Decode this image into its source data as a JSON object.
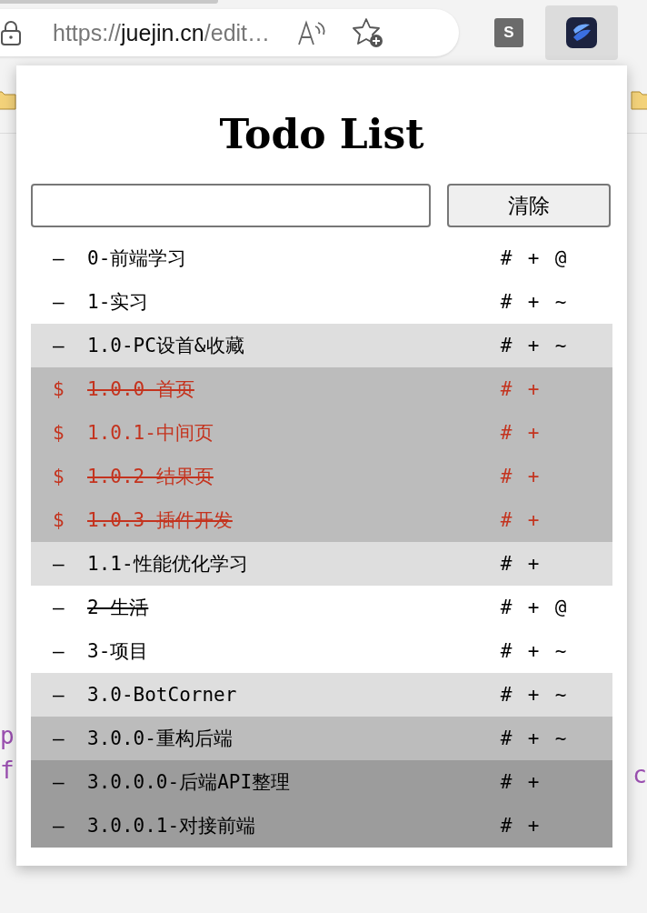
{
  "browser": {
    "url": {
      "scheme": "https://",
      "host": "juejin.cn",
      "path": "/edit…"
    },
    "extensions": [
      {
        "label": "S",
        "selected": false
      },
      {
        "kind": "app",
        "selected": true
      }
    ]
  },
  "page": {
    "left_fragments": [
      "p",
      "f"
    ],
    "right_fragments": [
      "c"
    ]
  },
  "popup": {
    "title": "Todo List",
    "clear_button": "清除",
    "items": [
      {
        "marker": "–",
        "text": "0-前端学习",
        "done": false,
        "highlighted": false,
        "actions": [
          "#",
          "+",
          "@"
        ]
      },
      {
        "marker": "–",
        "text": "1-实习",
        "done": false,
        "highlighted": false,
        "actions": [
          "#",
          "+",
          "~"
        ],
        "children": [
          {
            "marker": "–",
            "text": "1.0-PC设首&收藏",
            "done": false,
            "highlighted": false,
            "actions": [
              "#",
              "+",
              "~"
            ],
            "children": [
              {
                "marker": "$",
                "text": "1.0.0-首页",
                "done": true,
                "highlighted": true,
                "actions": [
                  "#",
                  "+"
                ]
              },
              {
                "marker": "$",
                "text": "1.0.1-中间页",
                "done": false,
                "highlighted": true,
                "actions": [
                  "#",
                  "+"
                ]
              },
              {
                "marker": "$",
                "text": "1.0.2-结果页",
                "done": true,
                "highlighted": true,
                "actions": [
                  "#",
                  "+"
                ]
              },
              {
                "marker": "$",
                "text": "1.0.3-插件开发",
                "done": true,
                "highlighted": true,
                "actions": [
                  "#",
                  "+"
                ]
              }
            ]
          },
          {
            "marker": "–",
            "text": "1.1-性能优化学习",
            "done": false,
            "highlighted": false,
            "actions": [
              "#",
              "+"
            ]
          }
        ]
      },
      {
        "marker": "–",
        "text": "2-生活",
        "done": true,
        "highlighted": false,
        "actions": [
          "#",
          "+",
          "@"
        ]
      },
      {
        "marker": "–",
        "text": "3-项目",
        "done": false,
        "highlighted": false,
        "actions": [
          "#",
          "+",
          "~"
        ],
        "children": [
          {
            "marker": "–",
            "text": "3.0-BotCorner",
            "done": false,
            "highlighted": false,
            "actions": [
              "#",
              "+",
              "~"
            ],
            "children": [
              {
                "marker": "–",
                "text": "3.0.0-重构后端",
                "done": false,
                "highlighted": false,
                "actions": [
                  "#",
                  "+",
                  "~"
                ],
                "children": [
                  {
                    "marker": "–",
                    "text": "3.0.0.0-后端API整理",
                    "done": false,
                    "highlighted": false,
                    "actions": [
                      "#",
                      "+"
                    ]
                  },
                  {
                    "marker": "–",
                    "text": "3.0.0.1-对接前端",
                    "done": false,
                    "highlighted": false,
                    "actions": [
                      "#",
                      "+"
                    ]
                  }
                ]
              }
            ]
          }
        ]
      }
    ]
  }
}
